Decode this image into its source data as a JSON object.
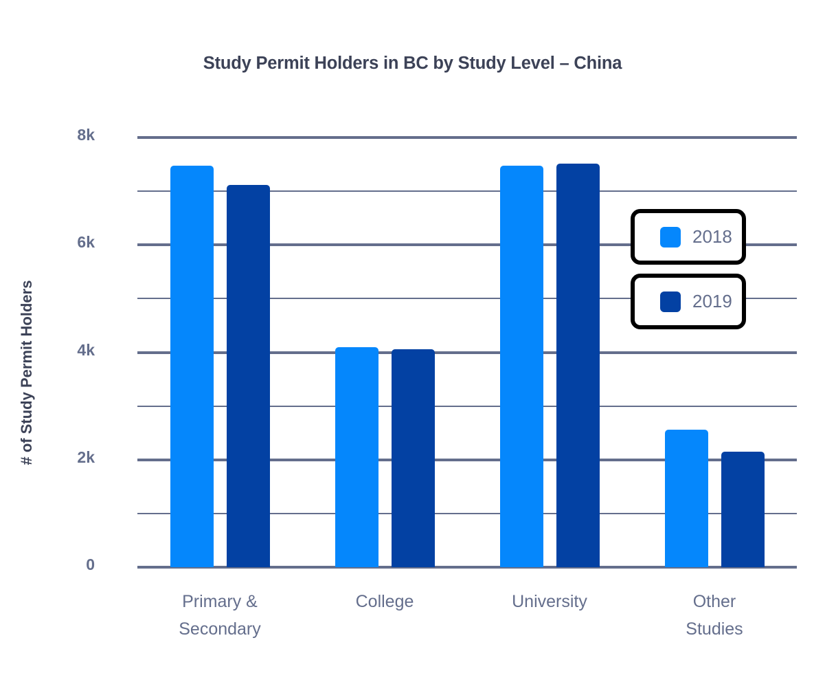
{
  "chart_data": {
    "type": "bar",
    "title": "Study Permit Holders in BC by Study Level – China",
    "xlabel": "",
    "ylabel": "# of Study Permit Holders",
    "categories": [
      "Primary &\nSecondary",
      "College",
      "University",
      "Other\nStudies"
    ],
    "series": [
      {
        "name": "2018",
        "color": "#0587fc",
        "values": [
          7480,
          4100,
          7480,
          2560
        ]
      },
      {
        "name": "2019",
        "color": "#0341a3",
        "values": [
          7120,
          4060,
          7520,
          2150
        ]
      }
    ],
    "ylim": [
      0,
      8000
    ],
    "yticks": [
      {
        "value": 8000,
        "label": "8k",
        "major": true
      },
      {
        "value": 7000,
        "label": "",
        "major": false
      },
      {
        "value": 6000,
        "label": "6k",
        "major": true
      },
      {
        "value": 5000,
        "label": "",
        "major": false
      },
      {
        "value": 4000,
        "label": "4k",
        "major": true
      },
      {
        "value": 3000,
        "label": "",
        "major": false
      },
      {
        "value": 2000,
        "label": "2k",
        "major": true
      },
      {
        "value": 1000,
        "label": "",
        "major": false
      },
      {
        "value": 0,
        "label": "0",
        "major": true
      }
    ],
    "grid": true,
    "legend_position": "right-inside",
    "gridline_color": "#646e8c",
    "title_color": "#3c4257",
    "label_color": "#646e8c"
  }
}
